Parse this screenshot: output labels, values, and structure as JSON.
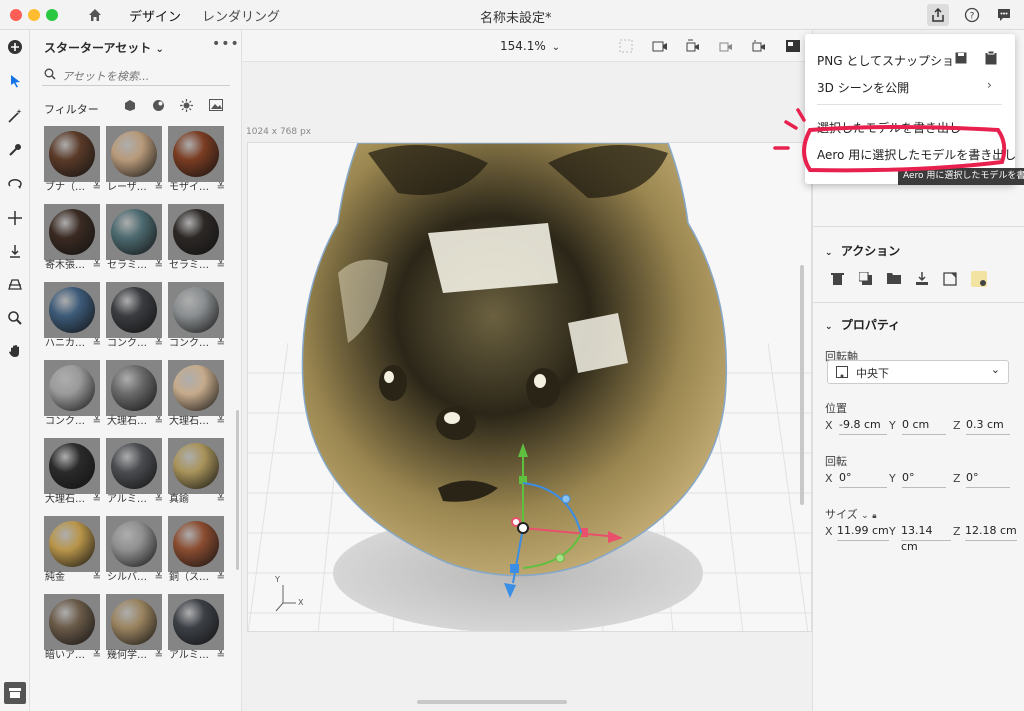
{
  "window": {
    "title": "名称未設定*",
    "tabs": [
      "デザイン",
      "レンダリング"
    ],
    "traffic_colors": [
      "#fd5f57",
      "#febc2e",
      "#29c840"
    ]
  },
  "toolbar_icons": [
    "add-icon",
    "select-icon",
    "magic-wand-icon",
    "eyedropper-icon",
    "orbit-icon",
    "move-icon",
    "drop-to-ground-icon",
    "perspective-icon",
    "zoom-icon",
    "hand-icon"
  ],
  "assets": {
    "header": "スターターアセット",
    "search_placeholder": "アセットを検索...",
    "filter_label": "フィルター",
    "tiles": [
      {
        "name": "ブナ（…",
        "color": "#5a3a28"
      },
      {
        "name": "レーザ…",
        "color": "#b89a7a"
      },
      {
        "name": "モザイ…",
        "color": "#7a3c22"
      },
      {
        "name": "寄木張…",
        "color": "#3a2a22"
      },
      {
        "name": "セラミ…",
        "color": "#4c6a70"
      },
      {
        "name": "セラミ…",
        "color": "#2c2826"
      },
      {
        "name": "ハニカ…",
        "color": "#3c5a78"
      },
      {
        "name": "コンク…",
        "color": "#3a3c40"
      },
      {
        "name": "コンク…",
        "color": "#8a8e90"
      },
      {
        "name": "コンク…",
        "color": "#9a9a9a"
      },
      {
        "name": "大理石…",
        "color": "#6a6a6a"
      },
      {
        "name": "大理石…",
        "color": "#c6ab8c"
      },
      {
        "name": "大理石…",
        "color": "#2a2a2a"
      },
      {
        "name": "アルミ…",
        "color": "#4a4c50"
      },
      {
        "name": "真鍮",
        "color": "#a8935a"
      },
      {
        "name": "純金",
        "color": "#b8954a"
      },
      {
        "name": "シルバ…",
        "color": "#909090"
      },
      {
        "name": "銅（ス…",
        "color": "#8a4c30"
      },
      {
        "name": "暗いア…",
        "color": "#6a5a48"
      },
      {
        "name": "幾何学…",
        "color": "#9a8460"
      },
      {
        "name": "アルミ…",
        "color": "#3c4046"
      }
    ]
  },
  "viewport": {
    "zoom": "154.1%",
    "canvas_size": "1024 x 768 px",
    "axis_x": "X",
    "axis_y": "Y"
  },
  "export_menu": {
    "items": [
      "PNG としてスナップショ",
      "3D シーンを公開",
      "選択したモデルを書き出し",
      "Aero 用に選択したモデルを書き出し"
    ],
    "tooltip": "Aero 用に選択したモデルを書き出し"
  },
  "actions": {
    "title": "アクション"
  },
  "properties": {
    "title": "プロパティ",
    "pivot_label": "回転軸",
    "pivot_value": "中央下",
    "position_label": "位置",
    "position": {
      "x": "-9.8 cm",
      "y": "0 cm",
      "z": "0.3 cm"
    },
    "rotation_label": "回転",
    "rotation": {
      "x": "0°",
      "y": "0°",
      "z": "0°"
    },
    "size_label": "サイズ",
    "size": {
      "x": "11.99 cm",
      "y": "13.14 cm",
      "z": "12.18 cm"
    },
    "axis_labels": {
      "x": "X",
      "y": "Y",
      "z": "Z"
    }
  }
}
